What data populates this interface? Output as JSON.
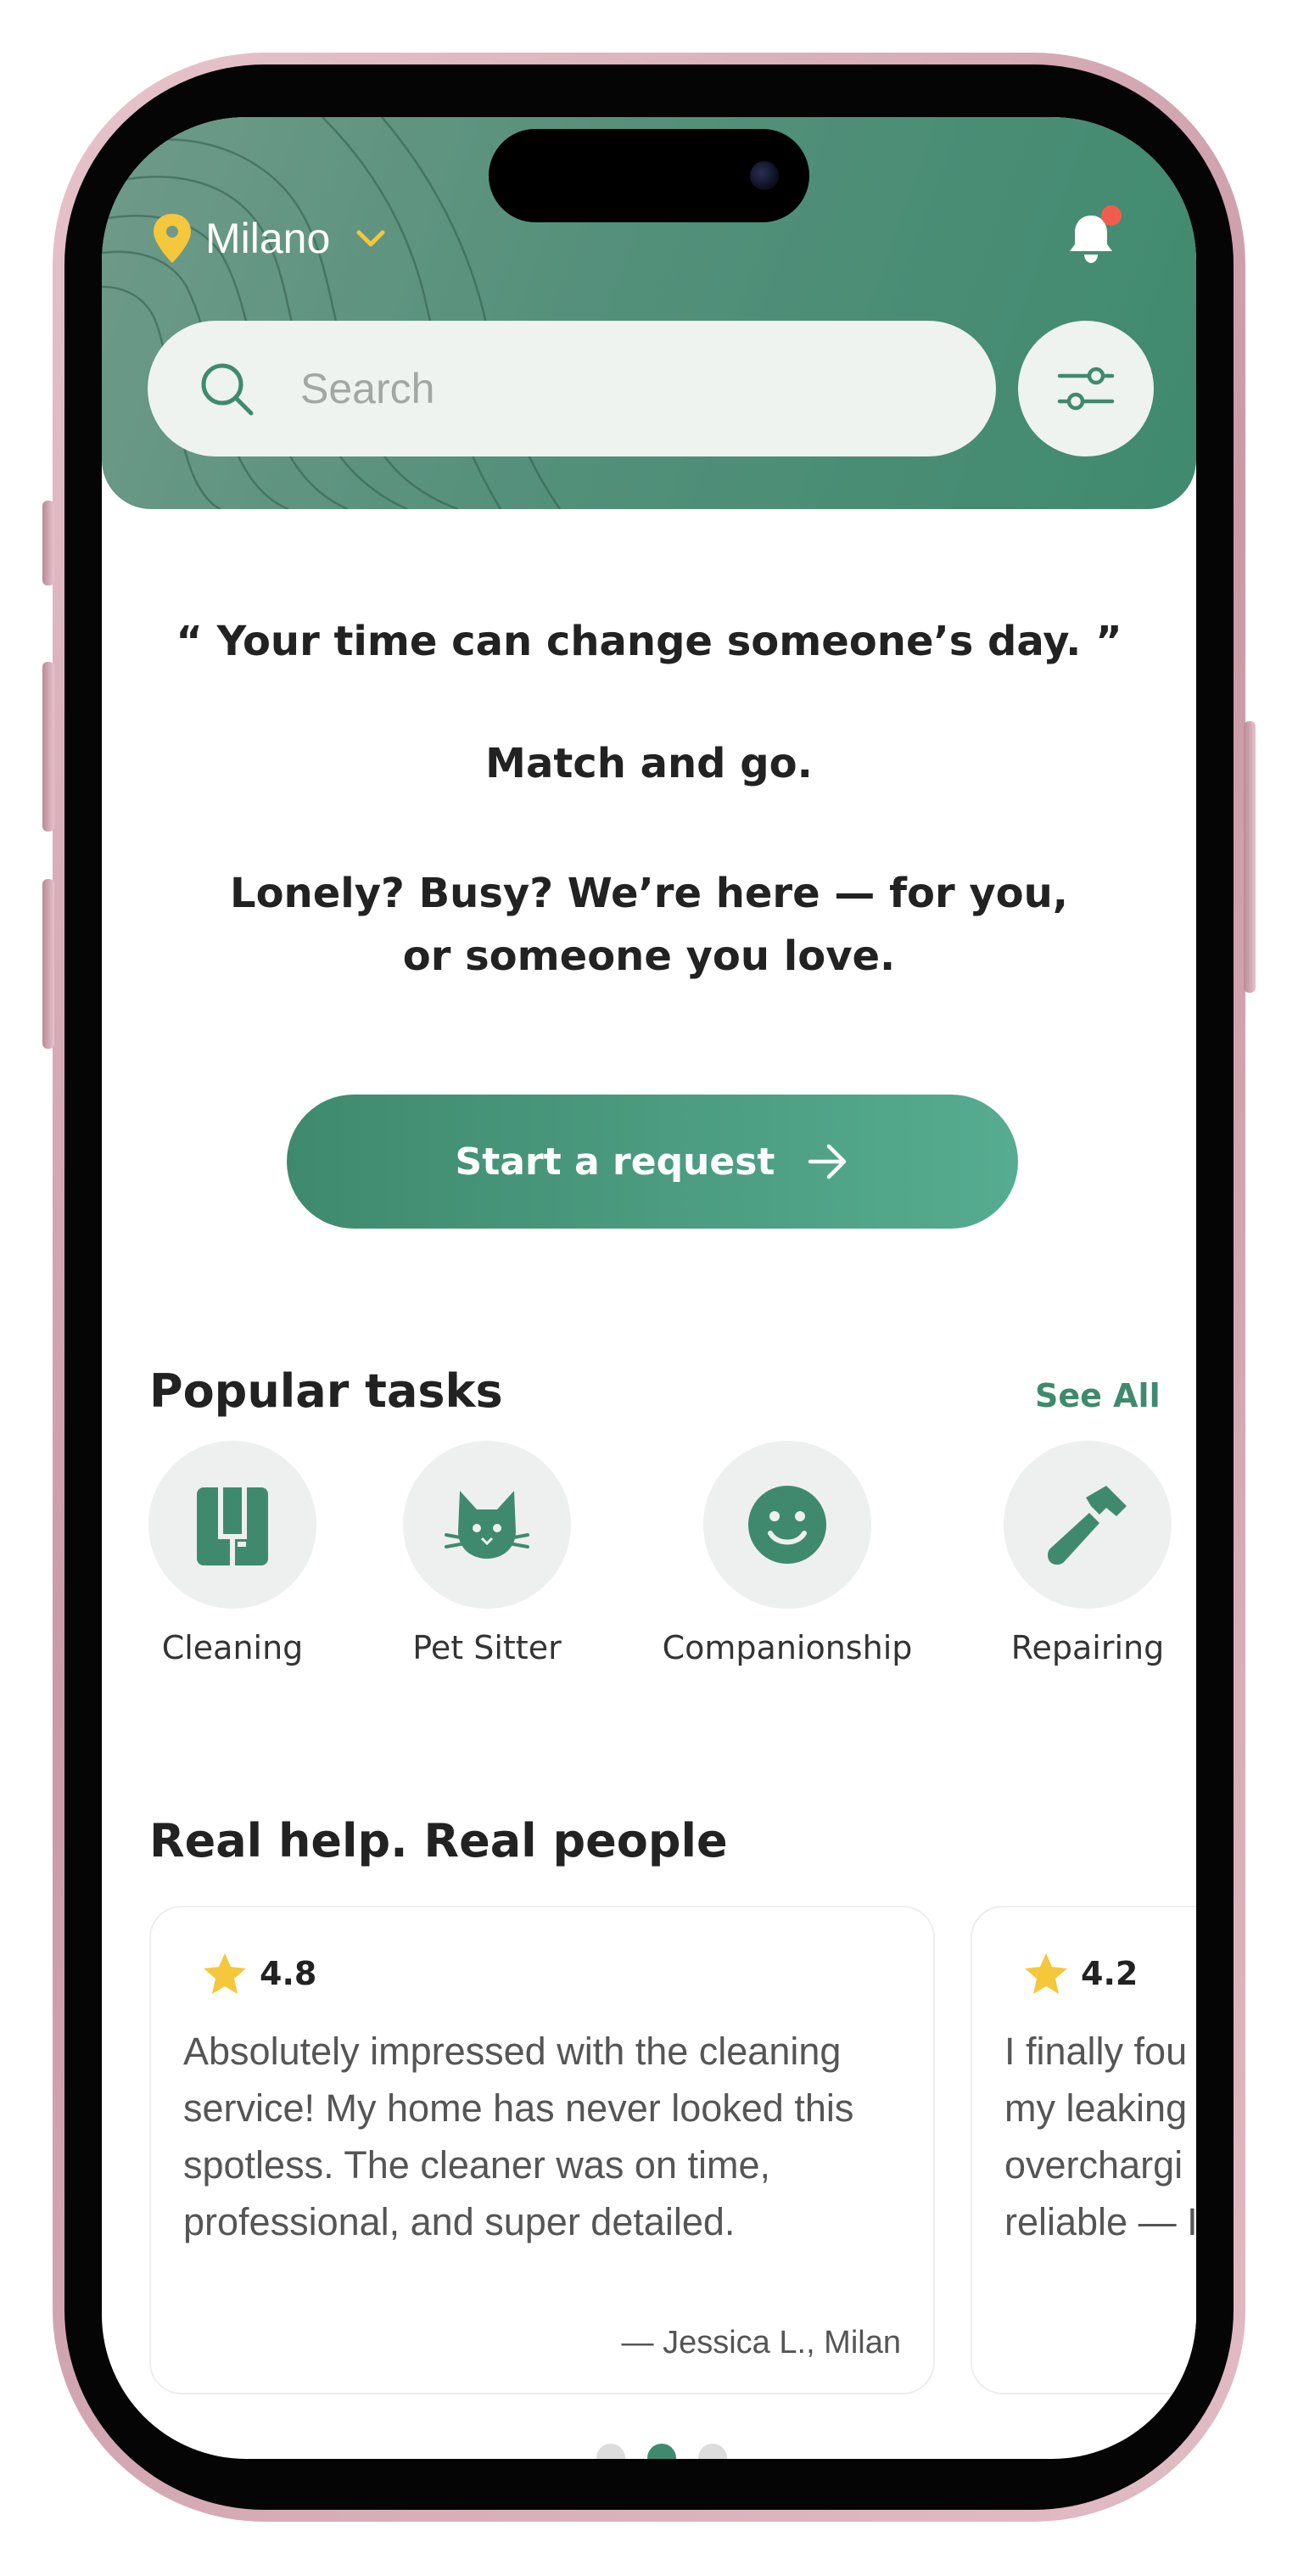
{
  "header": {
    "location": "Milano",
    "search_placeholder": "Search",
    "accent_color": "#3f8a6f",
    "pin_color": "#f5c73b",
    "notification_dot_color": "#f25c4e"
  },
  "hero": {
    "quote": "“ Your time can change someone’s day.  ”",
    "tagline": "Match and go.",
    "subline": "Lonely? Busy? We’re here — for you, or someone you love.",
    "cta_label": "Start a request"
  },
  "popular_tasks": {
    "title": "Popular tasks",
    "see_all": "See All",
    "items": [
      {
        "label": "Cleaning",
        "icon": "cleaning-icon"
      },
      {
        "label": "Pet Sitter",
        "icon": "cat-icon"
      },
      {
        "label": "Companionship",
        "icon": "smiley-icon"
      },
      {
        "label": "Repairing",
        "icon": "hammer-icon"
      }
    ]
  },
  "reviews": {
    "title": "Real help. Real people",
    "items": [
      {
        "rating": "4.8",
        "text": "Absolutely impressed with the cleaning service! My home has never looked this spotless. The cleaner was on time, professional, and super detailed.",
        "author": "— Jessica L., Milan"
      },
      {
        "rating": "4.2",
        "text": "I finally fou my leaking overchargi reliable — I"
      }
    ],
    "carousel_pages": 3,
    "active_page": 2
  }
}
